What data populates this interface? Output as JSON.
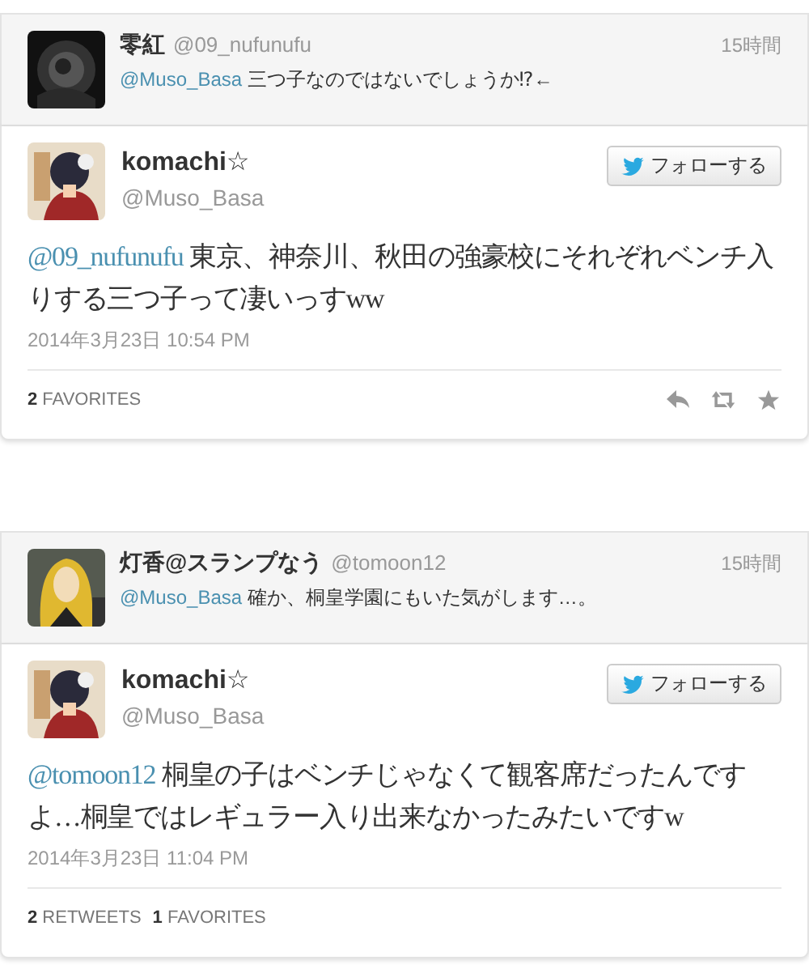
{
  "threads": [
    {
      "parent": {
        "name": "零紅",
        "handle": "@09_nufunufu",
        "time": "15時間",
        "mention": "@Muso_Basa",
        "text": "三つ子なのではないでしょうか⁉←"
      },
      "tweet": {
        "name": "komachi☆",
        "handle": "@Muso_Basa",
        "follow": "フォローする",
        "mention": "@09_nufunufu",
        "text": "東京、神奈川、秋田の強豪校にそれぞれベンチ入りする三つ子って凄いっすww",
        "date": "2014年3月23日  10:54 PM",
        "stats": [
          {
            "count": "2",
            "label": "FAVORITES"
          }
        ],
        "actions": [
          {
            "kind": "reply"
          },
          {
            "kind": "retweet"
          },
          {
            "kind": "favorite"
          }
        ]
      }
    },
    {
      "parent": {
        "name": "灯香@スランプなう",
        "handle": "@tomoon12",
        "time": "15時間",
        "mention": "@Muso_Basa",
        "text": "確か、桐皇学園にもいた気がします…。"
      },
      "tweet": {
        "name": "komachi☆",
        "handle": "@Muso_Basa",
        "follow": "フォローする",
        "mention": "@tomoon12",
        "text": "桐皇の子はベンチじゃなくて観客席だったんですよ…桐皇ではレギュラー入り出来なかったみたいですw",
        "date": "2014年3月23日  11:04 PM",
        "stats": [
          {
            "count": "2",
            "label": "RETWEETS"
          },
          {
            "count": "1",
            "label": "FAVORITES"
          }
        ]
      }
    }
  ]
}
